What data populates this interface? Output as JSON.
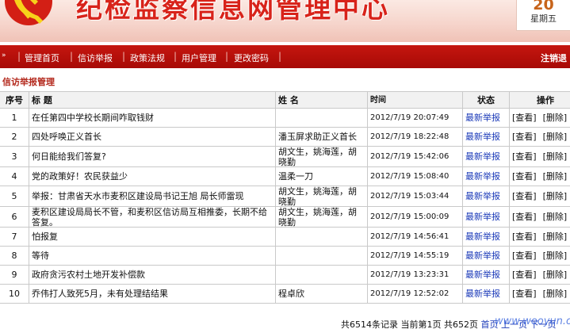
{
  "header": {
    "site_title": "纪检监察信息网管理中心",
    "date_day": "20",
    "date_weekday": "星期五",
    "colors": {
      "brand_red": "#c5160f",
      "title_red": "#d8231a",
      "link_blue": "#1a39b8"
    },
    "emblem_icon": "party-emblem-icon"
  },
  "nav": {
    "arrow": "»",
    "items": [
      "管理首页",
      "信访举报",
      "政策法规",
      "用户管理",
      "更改密码"
    ],
    "logout": "注销退"
  },
  "section_title": "信访举报管理",
  "table": {
    "columns": {
      "no": "序号",
      "title": "标 题",
      "name": "姓 名",
      "time": "时间",
      "status": "状态",
      "action": "操作"
    },
    "action_view": "[查看]",
    "action_delete": "[删除]",
    "rows": [
      {
        "no": "1",
        "title": "在任第四中学校长期间咋取钱财",
        "name": "",
        "time": "2012/7/19 20:07:49",
        "status": "最新举报"
      },
      {
        "no": "2",
        "title": "四处呼唤正义首长",
        "name": "潘玉屏求助正义首长",
        "time": "2012/7/19 18:22:48",
        "status": "最新举报"
      },
      {
        "no": "3",
        "title": "何日能给我们答复?",
        "name": "胡文生，姚海莲，胡晓勤",
        "time": "2012/7/19 15:42:06",
        "status": "最新举报"
      },
      {
        "no": "4",
        "title": "党的政策好！农民获益少",
        "name": "温柔一刀",
        "time": "2012/7/19 15:08:40",
        "status": "最新举报"
      },
      {
        "no": "5",
        "title": "举报：甘肃省天水市麦积区建设局书记王旭 局长师雷现",
        "name": "胡文生，姚海莲，胡晓勤",
        "time": "2012/7/19 15:03:44",
        "status": "最新举报"
      },
      {
        "no": "6",
        "title": "麦积区建设局局长不管，和麦积区信访局互相推委，长期不给答复。",
        "name": "胡文生，姚海莲，胡晓勤",
        "time": "2012/7/19 15:00:09",
        "status": "最新举报"
      },
      {
        "no": "7",
        "title": "怕报复",
        "name": "",
        "time": "2012/7/19 14:56:41",
        "status": "最新举报"
      },
      {
        "no": "8",
        "title": "等待",
        "name": "",
        "time": "2012/7/19 14:55:19",
        "status": "最新举报"
      },
      {
        "no": "9",
        "title": "政府贪污农村土地开发补偿款",
        "name": "",
        "time": "2012/7/19 13:23:31",
        "status": "最新举报"
      },
      {
        "no": "10",
        "title": "乔伟打人致死5月，未有处理结结果",
        "name": "程卓欣",
        "time": "2012/7/19 12:52:02",
        "status": "最新举报"
      }
    ]
  },
  "footer": {
    "summary": "共6514条记录  当前第1页  共652页",
    "first": "首页",
    "prev": "上一页",
    "next": "下一页"
  },
  "watermark": "www.wooyun.org"
}
